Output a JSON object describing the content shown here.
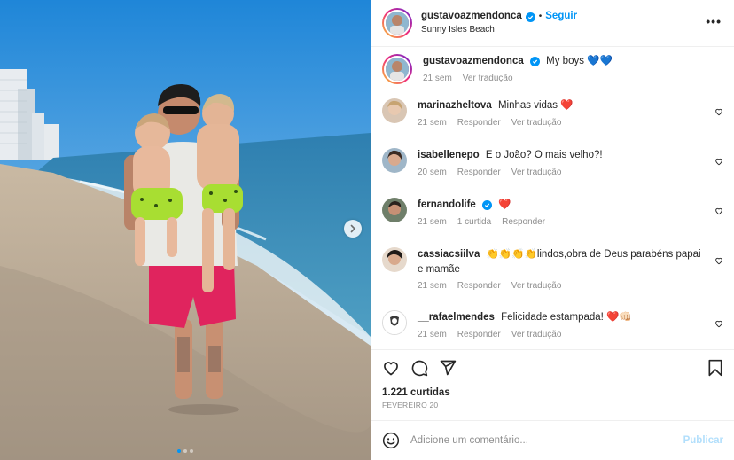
{
  "post": {
    "author": "gustavoazmendonca",
    "location": "Sunny Isles Beach",
    "follow_label": "Seguir",
    "separator": "•",
    "more_label": "•••"
  },
  "caption": {
    "username": "gustavoazmendonca",
    "text": "My boys 💙💙",
    "time": "21 sem",
    "translate": "Ver tradução"
  },
  "comments": [
    {
      "username": "marinazheltova",
      "text": "Minhas vidas ❤️",
      "time": "21 sem",
      "reply": "Responder",
      "translate": "Ver tradução",
      "likes": ""
    },
    {
      "username": "isabellenepo",
      "text": "E o João? O mais velho?!",
      "time": "20 sem",
      "reply": "Responder",
      "translate": "Ver tradução",
      "likes": ""
    },
    {
      "username": "fernandolife",
      "text": "❤️",
      "time": "21 sem",
      "reply": "Responder",
      "translate": "",
      "likes": "1 curtida"
    },
    {
      "username": "cassiacsiilva",
      "text": "👏👏👏👏lindos,obra de Deus parabéns papai e mamãe",
      "time": "21 sem",
      "reply": "Responder",
      "translate": "Ver tradução",
      "likes": ""
    },
    {
      "username": "__rafaelmendes",
      "text": "Felicidade estampada! ❤️👊🏻",
      "time": "21 sem",
      "reply": "Responder",
      "translate": "Ver tradução",
      "likes": ""
    }
  ],
  "stats": {
    "likes": "1.221 curtidas",
    "date": "FEVEREIRO 20"
  },
  "composer": {
    "placeholder": "Adicione um comentário...",
    "publish": "Publicar"
  },
  "colors": {
    "accent": "#0095f6",
    "heart_red": "#ed4956",
    "muted": "#8e8e8e"
  },
  "icons": {
    "heart": "heart-icon",
    "comment": "comment-icon",
    "share": "share-icon",
    "save": "bookmark-icon",
    "emoji": "emoji-icon",
    "next": "chevron-right-icon",
    "verified": "verified-badge-icon",
    "more": "more-options-icon"
  },
  "carousel": {
    "count": 3,
    "active": 1
  }
}
